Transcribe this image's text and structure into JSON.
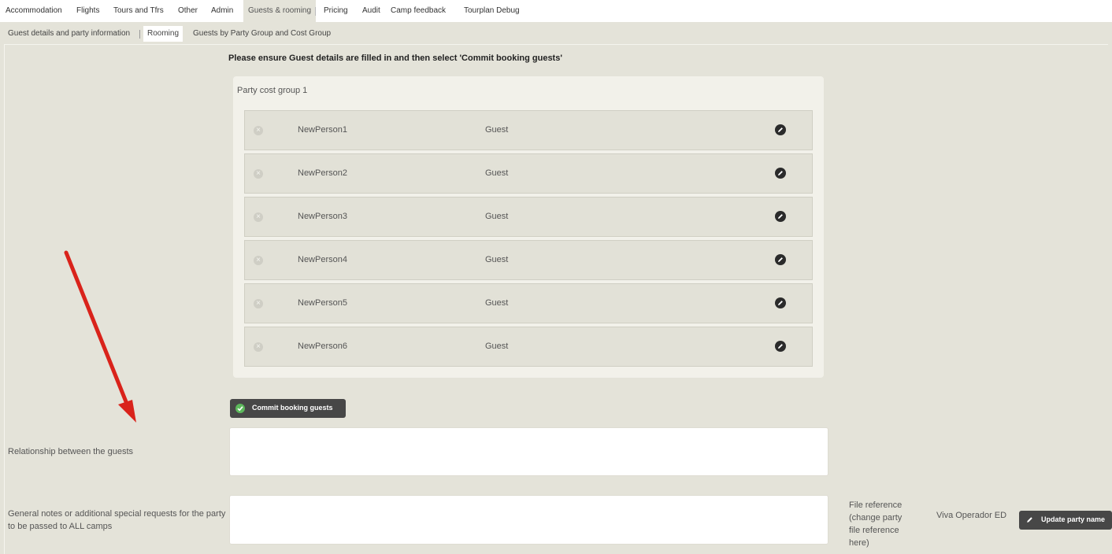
{
  "top_tabs": [
    "Accommodation",
    "Flights",
    "Tours and Tfrs",
    "Other",
    "Admin",
    "Guests & rooming",
    "Pricing",
    "Audit",
    "Camp feedback",
    "Tourplan Debug"
  ],
  "active_top_tab": "Guests & rooming",
  "sub_tabs": [
    "Guest details and party information",
    "Rooming",
    "Guests by Party Group and Cost Group"
  ],
  "active_sub_tab": "Rooming",
  "instruction": "Please ensure Guest details are filled in and then select 'Commit booking guests'",
  "party_group": {
    "title": "Party cost group 1",
    "guests": [
      {
        "name": "NewPerson1",
        "role": "Guest"
      },
      {
        "name": "NewPerson2",
        "role": "Guest"
      },
      {
        "name": "NewPerson3",
        "role": "Guest"
      },
      {
        "name": "NewPerson4",
        "role": "Guest"
      },
      {
        "name": "NewPerson5",
        "role": "Guest"
      },
      {
        "name": "NewPerson6",
        "role": "Guest"
      }
    ]
  },
  "commit_button": "Commit booking guests",
  "relationship_label": "Relationship between the guests",
  "relationship_value": "",
  "general_notes_label": "General notes or additional special requests for the party to be passed to ALL camps",
  "general_notes_value": "",
  "file_reference_label": "File reference (change party file reference here)",
  "file_reference_value": "Viva Operador ED",
  "update_button": "Update party name",
  "icons": {
    "remove": "remove-circle-icon",
    "edit": "pencil-edit-icon",
    "commit": "check-circle-icon",
    "update": "pencil-icon",
    "annotation": "red-arrow-annotation"
  },
  "colors": {
    "background": "#e4e3d9",
    "button": "#474747",
    "check": "#5db85c",
    "annotation_arrow": "#d9231b"
  }
}
